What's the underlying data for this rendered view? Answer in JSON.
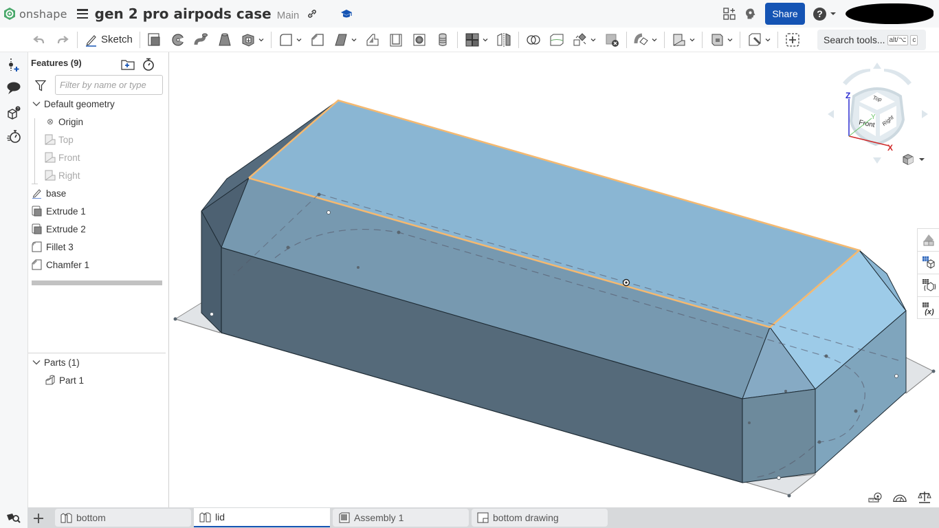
{
  "app": {
    "brand": "onshape",
    "document_title": "gen 2 pro airpods case",
    "branch": "Main",
    "share_label": "Share",
    "help_label": "?"
  },
  "toolbar": {
    "sketch_label": "Sketch",
    "search_label": "Search tools...",
    "search_shortcut_mod": "alt/⌥",
    "search_shortcut_key": "c"
  },
  "features_panel": {
    "header": "Features (9)",
    "filter_placeholder": "Filter by name or type",
    "default_geometry": {
      "label": "Default geometry",
      "items": [
        {
          "label": "Origin",
          "icon": "origin-icon",
          "dim": false
        },
        {
          "label": "Top",
          "icon": "plane-icon",
          "dim": true
        },
        {
          "label": "Front",
          "icon": "plane-icon",
          "dim": true
        },
        {
          "label": "Right",
          "icon": "plane-icon",
          "dim": true
        }
      ]
    },
    "features": [
      {
        "label": "base",
        "icon": "sketch-icon"
      },
      {
        "label": "Extrude 1",
        "icon": "extrude-icon"
      },
      {
        "label": "Extrude 2",
        "icon": "extrude-icon"
      },
      {
        "label": "Fillet 3",
        "icon": "fillet-icon"
      },
      {
        "label": "Chamfer 1",
        "icon": "chamfer-icon"
      }
    ],
    "parts": {
      "label": "Parts (1)",
      "items": [
        {
          "label": "Part 1",
          "icon": "part-icon"
        }
      ]
    }
  },
  "viewcube": {
    "faces": {
      "top": "Top",
      "front": "Front",
      "right": "Right"
    },
    "axes": {
      "x": "X",
      "y": "Y",
      "z": "Z"
    }
  },
  "tabs": [
    {
      "label": "bottom",
      "type": "part-studio",
      "active": false
    },
    {
      "label": "lid",
      "type": "part-studio",
      "active": true
    },
    {
      "label": "Assembly 1",
      "type": "assembly",
      "active": false
    },
    {
      "label": "bottom drawing",
      "type": "drawing",
      "active": false
    }
  ],
  "colors": {
    "accent": "#1554b4",
    "selection_edge": "#f5b970",
    "part_top_face": "#8ab6d3",
    "part_side_dark": "#566a7a"
  }
}
